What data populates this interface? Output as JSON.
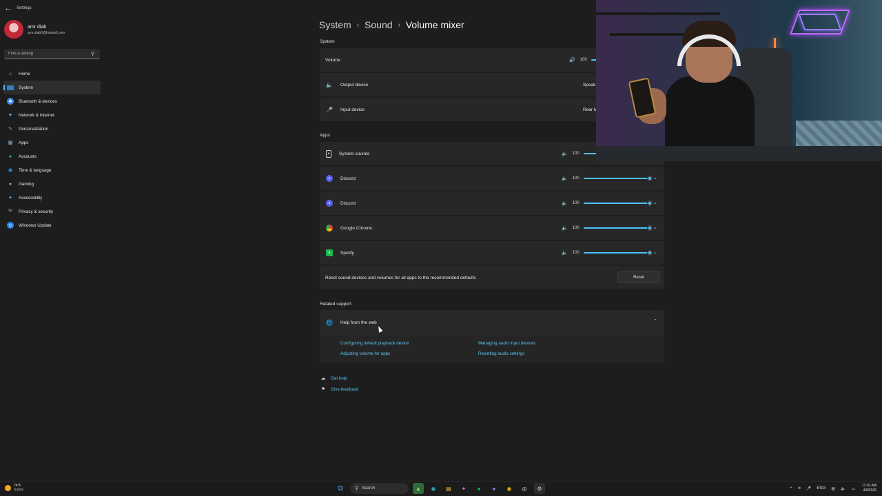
{
  "window": {
    "title": "Settings"
  },
  "profile": {
    "name": "amr diab",
    "email": "amr.diab0@hotmail.com"
  },
  "search": {
    "placeholder": "Find a setting"
  },
  "sidebar": {
    "items": [
      {
        "label": "Home",
        "icon": "home-icon",
        "color": "#e8a36b"
      },
      {
        "label": "System",
        "icon": "system-icon",
        "color": "#4aa8ff",
        "active": true
      },
      {
        "label": "Bluetooth & devices",
        "icon": "bluetooth-icon",
        "color": "#3b8ef0"
      },
      {
        "label": "Network & internet",
        "icon": "wifi-icon",
        "color": "#6bb6ff"
      },
      {
        "label": "Personalization",
        "icon": "brush-icon",
        "color": "#f08a3c"
      },
      {
        "label": "Apps",
        "icon": "apps-icon",
        "color": "#8fb3d9"
      },
      {
        "label": "Accounts",
        "icon": "person-icon",
        "color": "#3fc18c"
      },
      {
        "label": "Time & language",
        "icon": "globe-clock-icon",
        "color": "#3aa0e8"
      },
      {
        "label": "Gaming",
        "icon": "gamepad-icon",
        "color": "#a8a8a8"
      },
      {
        "label": "Accessibility",
        "icon": "accessibility-icon",
        "color": "#5aa9f0"
      },
      {
        "label": "Privacy & security",
        "icon": "shield-icon",
        "color": "#a0a0a0"
      },
      {
        "label": "Windows Update",
        "icon": "update-icon",
        "color": "#2d8ae8"
      }
    ]
  },
  "breadcrumb": {
    "part1": "System",
    "part2": "Sound",
    "current": "Volume mixer"
  },
  "system_section": {
    "heading": "System",
    "volume": {
      "label": "Volume",
      "value": "100"
    },
    "output": {
      "label": "Output device",
      "value": "Speak"
    },
    "input": {
      "label": "Input device",
      "value": "Rear M"
    }
  },
  "apps_section": {
    "heading": "Apps",
    "apps": [
      {
        "name": "System sounds",
        "volume": "100",
        "level": 1.0,
        "icon": "system-sounds-icon"
      },
      {
        "name": "Discord",
        "volume": "100",
        "level": 1.0,
        "icon": "discord-icon"
      },
      {
        "name": "Discord",
        "volume": "100",
        "level": 1.0,
        "icon": "discord-icon"
      },
      {
        "name": "Google Chrome",
        "volume": "100",
        "level": 1.0,
        "icon": "chrome-icon"
      },
      {
        "name": "Spotify",
        "volume": "100",
        "level": 1.0,
        "icon": "spotify-icon"
      }
    ]
  },
  "reset_row": {
    "label": "Reset sound devices and volumes for all apps to the recommended defaults",
    "button": "Reset"
  },
  "related": {
    "heading": "Related support",
    "panel_title": "Help from the web",
    "links": [
      "Configuring default playback device",
      "Managing audio input devices",
      "Adjusting volume for apps",
      "Resetting audio settings"
    ]
  },
  "footer": {
    "get_help": "Get help",
    "feedback": "Give feedback"
  },
  "taskbar": {
    "weather_temp": "74°F",
    "weather_cond": "Sunny",
    "search_label": "Search",
    "lang": "ENG",
    "time": "11:01 AM",
    "date": "4/9/2026"
  },
  "colors": {
    "accent": "#4cc2ff",
    "link": "#5fc4f2"
  }
}
